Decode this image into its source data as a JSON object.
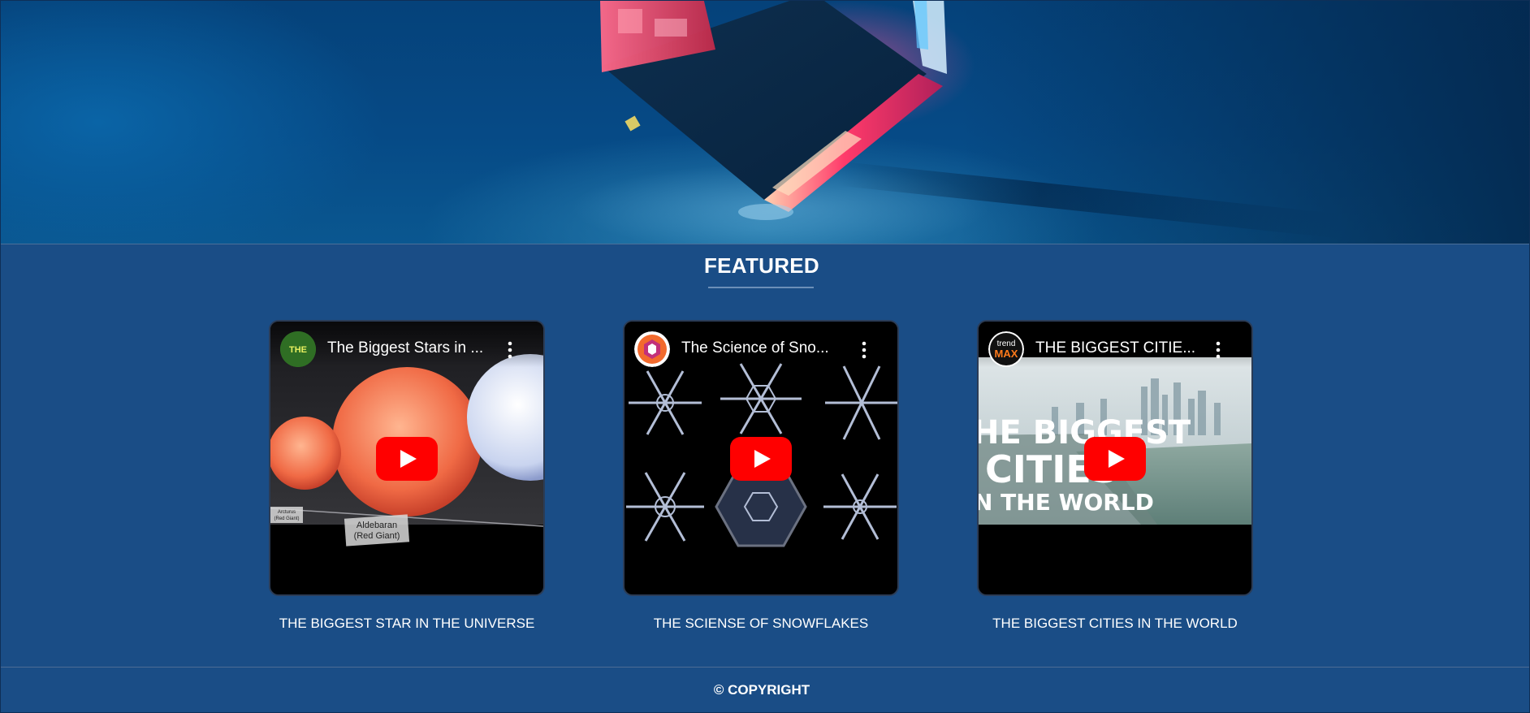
{
  "featured": {
    "title": "FEATURED"
  },
  "videos": [
    {
      "title": "The Biggest Stars in ...",
      "caption": "THE BIGGEST STAR IN THE UNIVERSE",
      "thumb_labels": {
        "star1": "Aldebaran",
        "star1_sub": "(Red Giant)",
        "star2": "Arcturus",
        "star2_sub": "(Red Giant)"
      },
      "avatar_text": "THE"
    },
    {
      "title": "The Science of Sno...",
      "caption": "THE SCIENSE OF SNOWFLAKES"
    },
    {
      "title": "THE BIGGEST CITIE...",
      "caption": "THE BIGGEST CITIES IN THE WORLD",
      "avatar_text_top": "trend",
      "avatar_text_bottom": "MAX",
      "thumb_lines": [
        "HE BIGGEST",
        "CITIES",
        "N THE WORLD"
      ]
    }
  ],
  "footer": {
    "copyright": "© COPYRIGHT"
  },
  "colors": {
    "background": "#1a4d86",
    "youtube_red": "#ff0000",
    "hero": "#064a86"
  },
  "icons": [
    "play-icon",
    "more-vert-icon",
    "channel-avatar"
  ]
}
